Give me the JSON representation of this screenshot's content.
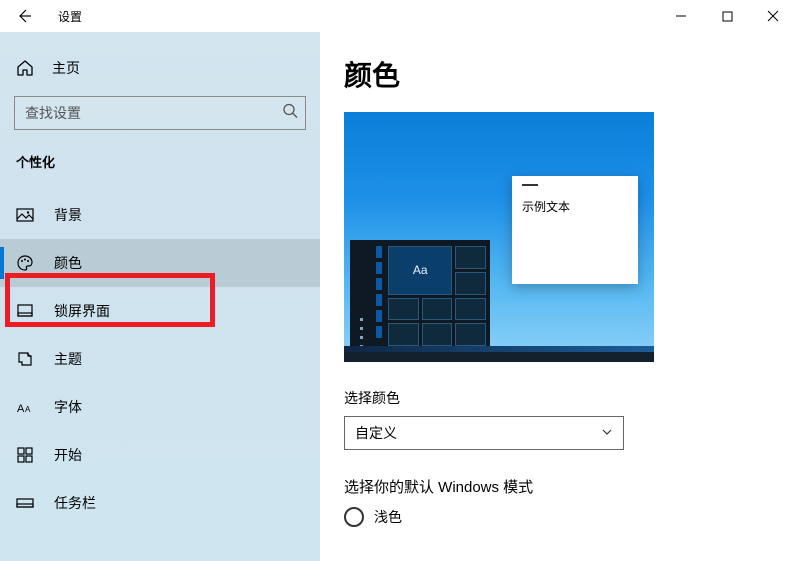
{
  "titlebar": {
    "app_title": "设置"
  },
  "sidebar": {
    "home_label": "主页",
    "search_placeholder": "查找设置",
    "section_label": "个性化",
    "items": [
      {
        "label": "背景"
      },
      {
        "label": "颜色"
      },
      {
        "label": "锁屏界面"
      },
      {
        "label": "主题"
      },
      {
        "label": "字体"
      },
      {
        "label": "开始"
      },
      {
        "label": "任务栏"
      }
    ],
    "active_index": 1,
    "highlight_index": 1
  },
  "content": {
    "heading": "颜色",
    "preview": {
      "sample_text": "示例文本",
      "tile_label": "Aa"
    },
    "select_color_label": "选择颜色",
    "select_color_value": "自定义",
    "windows_mode_label": "选择你的默认 Windows 模式",
    "windows_mode_options": [
      {
        "label": "浅色",
        "selected": false
      }
    ]
  }
}
